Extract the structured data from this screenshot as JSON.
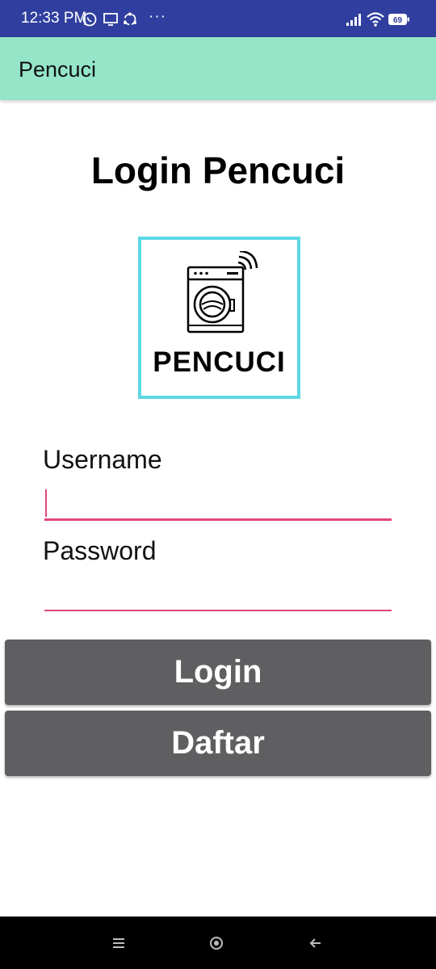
{
  "status_bar": {
    "time": "12:33 PM",
    "more": "···",
    "battery": "69",
    "icons": [
      "whatsapp-icon",
      "screen-icon",
      "sync-icon",
      "signal-icon",
      "wifi-icon",
      "battery-icon"
    ]
  },
  "app_bar": {
    "title": "Pencuci"
  },
  "main": {
    "title": "Login Pencuci",
    "logo_text": "PENCUCI",
    "username_label": "Username",
    "username_value": "",
    "password_label": "Password",
    "password_value": "",
    "login_label": "Login",
    "register_label": "Daftar"
  },
  "nav_bar": {
    "icons": [
      "menu-icon",
      "home-icon",
      "back-icon"
    ]
  },
  "colors": {
    "status_bar": "#303f9f",
    "app_bar": "#95e5c9",
    "logo_border": "#5dd8e6",
    "input_accent": "#e0457f",
    "button": "#5f5f61"
  }
}
